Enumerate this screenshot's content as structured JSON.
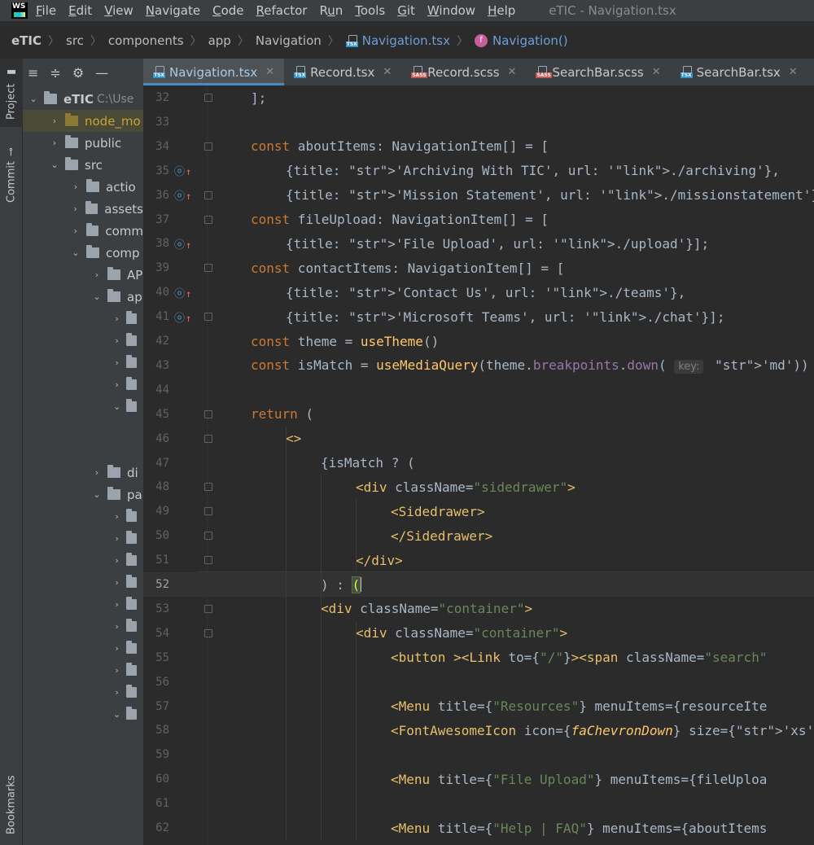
{
  "menubar": {
    "logo": "WS",
    "items": [
      "File",
      "Edit",
      "View",
      "Navigate",
      "Code",
      "Refactor",
      "Run",
      "Tools",
      "Git",
      "Window",
      "Help"
    ],
    "mnemonics": [
      "F",
      "E",
      "V",
      "N",
      "C",
      "R",
      "u",
      "T",
      "G",
      "W",
      "H"
    ],
    "window_title": "eTIC - Navigation.tsx"
  },
  "breadcrumb": {
    "root": "eTIC",
    "items": [
      "src",
      "components",
      "app",
      "Navigation"
    ],
    "file": "Navigation.tsx",
    "function": "Navigation()"
  },
  "toolstrip": {
    "project_label": "Project",
    "commit_label": "Commit",
    "bookmarks_label": "Bookmarks"
  },
  "project_tree": {
    "root_name": "eTIC",
    "root_path": "C:\\Use",
    "rows": [
      {
        "label": "node_mo",
        "type": "node_modules"
      },
      {
        "label": "public"
      },
      {
        "label": "src"
      },
      {
        "label": "actio"
      },
      {
        "label": "assets"
      },
      {
        "label": "comm"
      },
      {
        "label": "comp"
      },
      {
        "label": "AP"
      },
      {
        "label": "ap"
      },
      {
        "label": ""
      },
      {
        "label": ""
      },
      {
        "label": ""
      },
      {
        "label": ""
      },
      {
        "label": ""
      },
      {
        "label": "di"
      },
      {
        "label": "pa"
      },
      {
        "label": ""
      },
      {
        "label": ""
      },
      {
        "label": ""
      },
      {
        "label": ""
      },
      {
        "label": ""
      },
      {
        "label": ""
      },
      {
        "label": ""
      },
      {
        "label": ""
      },
      {
        "label": ""
      },
      {
        "label": ""
      },
      {
        "label": ""
      },
      {
        "label": ""
      }
    ]
  },
  "tabs": [
    {
      "label": "Navigation.tsx",
      "icon": "tsx-icon",
      "active": true
    },
    {
      "label": "Record.tsx",
      "icon": "tsx-icon"
    },
    {
      "label": "Record.scss",
      "icon": "sass-icon"
    },
    {
      "label": "SearchBar.scss",
      "icon": "sass-icon"
    },
    {
      "label": "SearchBar.tsx",
      "icon": "tsx-icon"
    }
  ],
  "editor": {
    "current_line": 52,
    "lines": [
      {
        "n": "32",
        "text": "];"
      },
      {
        "n": "33",
        "text": ""
      },
      {
        "n": "34",
        "text": "const aboutItems: NavigationItem[] = ["
      },
      {
        "n": "35",
        "text": "{title: 'Archiving With TIC', url: './archiving'},"
      },
      {
        "n": "36",
        "text": "{title: 'Mission Statement', url: './missionstatement'}];"
      },
      {
        "n": "37",
        "text": "const fileUpload: NavigationItem[] = ["
      },
      {
        "n": "38",
        "text": "{title: 'File Upload', url: './upload'}];"
      },
      {
        "n": "39",
        "text": "const contactItems: NavigationItem[] = ["
      },
      {
        "n": "40",
        "text": "{title: 'Contact Us', url: './teams'},"
      },
      {
        "n": "41",
        "text": "{title: 'Microsoft Teams', url: './chat'}];"
      },
      {
        "n": "42",
        "text": "const theme = useTheme()"
      },
      {
        "n": "43",
        "text": "const isMatch = useMediaQuery(theme.breakpoints.down( key: 'md'))"
      },
      {
        "n": "44",
        "text": ""
      },
      {
        "n": "45",
        "text": "return ("
      },
      {
        "n": "46",
        "text": "<>"
      },
      {
        "n": "47",
        "text": "{isMatch ? ("
      },
      {
        "n": "48",
        "text": "<div className=\"sidedrawer\">"
      },
      {
        "n": "49",
        "text": "<Sidedrawer>"
      },
      {
        "n": "50",
        "text": "</Sidedrawer>"
      },
      {
        "n": "51",
        "text": "</div>"
      },
      {
        "n": "52",
        "text": ") : ("
      },
      {
        "n": "53",
        "text": "<div className=\"container\">"
      },
      {
        "n": "54",
        "text": "<div className=\"container\">"
      },
      {
        "n": "55",
        "text": "<button ><Link to={\"/\"}><span className=\"search\""
      },
      {
        "n": "56",
        "text": ""
      },
      {
        "n": "57",
        "text": "<Menu title={\"Resources\"} menuItems={resourceIte"
      },
      {
        "n": "58",
        "text": "<FontAwesomeIcon icon={faChevronDown} size={'xs'"
      },
      {
        "n": "59",
        "text": ""
      },
      {
        "n": "60",
        "text": "<Menu title={\"File Upload\"} menuItems={fileUploa"
      },
      {
        "n": "61",
        "text": ""
      },
      {
        "n": "62",
        "text": "<Menu title={\"Help | FAQ\"} menuItems={aboutItems"
      }
    ]
  },
  "colors": {
    "editor_bg": "#2b2b2b",
    "panel_bg": "#3c3f41",
    "keyword": "#cc7832",
    "string": "#6a8759",
    "tag": "#e8bf6a",
    "function": "#ffc66d",
    "property": "#9876aa"
  }
}
